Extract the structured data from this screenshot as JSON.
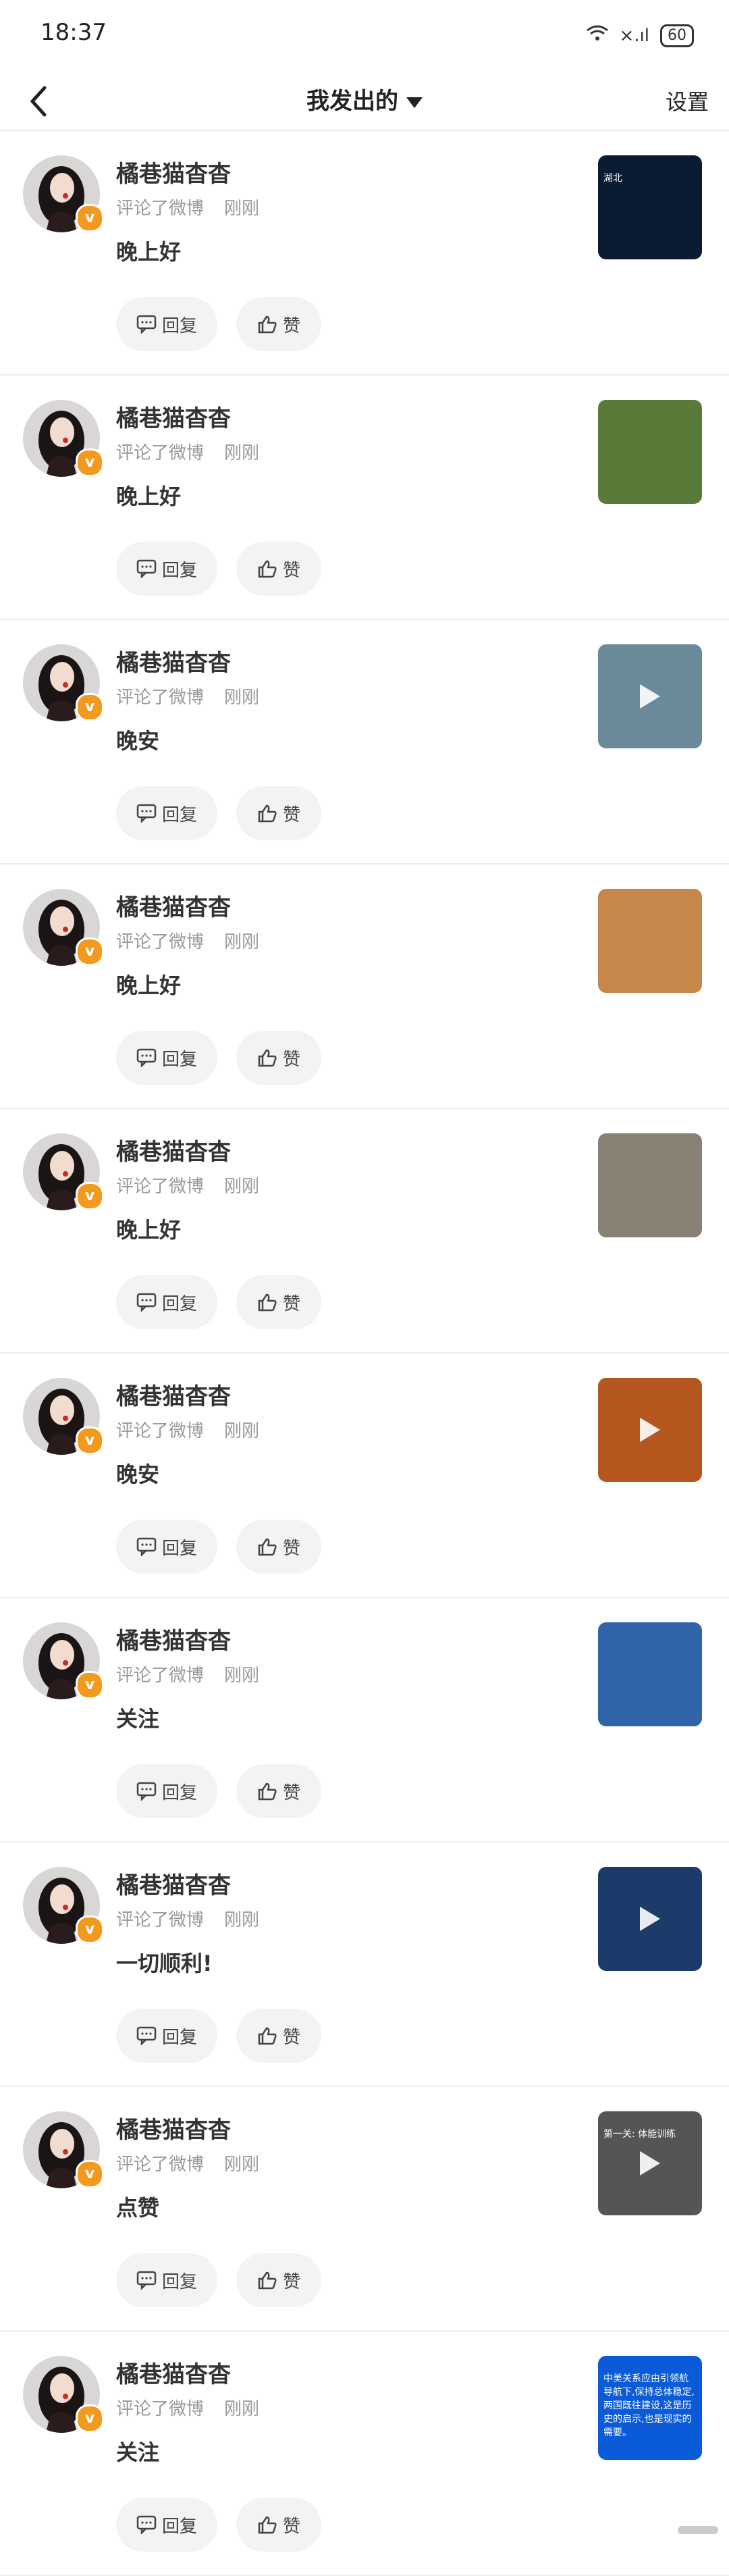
{
  "status_bar": {
    "time": "18:37",
    "signal": "×.ıl",
    "battery": "60"
  },
  "navbar": {
    "title": "我发出的",
    "settings_label": "设置"
  },
  "items": [
    {
      "user": "橘巷猫杳杳",
      "meta_action": "评论了微博",
      "meta_time": "刚刚",
      "text": "晚上好",
      "reply_label": "回复",
      "like_label": "赞",
      "thumb_bg": "#0b1b33",
      "thumb_text": "湖北",
      "thumb_video": false
    },
    {
      "user": "橘巷猫杳杳",
      "meta_action": "评论了微博",
      "meta_time": "刚刚",
      "text": "晚上好",
      "reply_label": "回复",
      "like_label": "赞",
      "thumb_bg": "#5a7a3a",
      "thumb_text": "",
      "thumb_video": false
    },
    {
      "user": "橘巷猫杳杳",
      "meta_action": "评论了微博",
      "meta_time": "刚刚",
      "text": "晚安",
      "reply_label": "回复",
      "like_label": "赞",
      "thumb_bg": "#6a8a9a",
      "thumb_text": "",
      "thumb_video": true
    },
    {
      "user": "橘巷猫杳杳",
      "meta_action": "评论了微博",
      "meta_time": "刚刚",
      "text": "晚上好",
      "reply_label": "回复",
      "like_label": "赞",
      "thumb_bg": "#c7864a",
      "thumb_text": "",
      "thumb_video": false
    },
    {
      "user": "橘巷猫杳杳",
      "meta_action": "评论了微博",
      "meta_time": "刚刚",
      "text": "晚上好",
      "reply_label": "回复",
      "like_label": "赞",
      "thumb_bg": "#8a8175",
      "thumb_text": "",
      "thumb_video": false
    },
    {
      "user": "橘巷猫杳杳",
      "meta_action": "评论了微博",
      "meta_time": "刚刚",
      "text": "晚安",
      "reply_label": "回复",
      "like_label": "赞",
      "thumb_bg": "#b5561e",
      "thumb_text": "",
      "thumb_video": true
    },
    {
      "user": "橘巷猫杳杳",
      "meta_action": "评论了微博",
      "meta_time": "刚刚",
      "text": "关注",
      "reply_label": "回复",
      "like_label": "赞",
      "thumb_bg": "#2f64a8",
      "thumb_text": "",
      "thumb_video": false
    },
    {
      "user": "橘巷猫杳杳",
      "meta_action": "评论了微博",
      "meta_time": "刚刚",
      "text": "一切顺利!",
      "reply_label": "回复",
      "like_label": "赞",
      "thumb_bg": "#1d3b6a",
      "thumb_text": "",
      "thumb_video": true
    },
    {
      "user": "橘巷猫杳杳",
      "meta_action": "评论了微博",
      "meta_time": "刚刚",
      "text": "点赞",
      "reply_label": "回复",
      "like_label": "赞",
      "thumb_bg": "#555555",
      "thumb_text": "第一关: 体能训练",
      "thumb_video": true
    },
    {
      "user": "橘巷猫杳杳",
      "meta_action": "评论了微博",
      "meta_time": "刚刚",
      "text": "关注",
      "reply_label": "回复",
      "like_label": "赞",
      "thumb_bg": "#0b5bd8",
      "thumb_text": "中美关系应由引领航导航下,保持总体稳定,两国既往建设,这是历史的启示,也是现实的需要。",
      "thumb_video": false
    }
  ],
  "colors": {
    "badge": "#f39a1e",
    "button_bg": "#f3f3f3",
    "divider": "#eeeeee"
  },
  "icons": {
    "back": "chevron-left-icon",
    "reply": "comment-bubble-icon",
    "like": "thumbs-up-icon",
    "verified": "verified-badge-icon"
  }
}
